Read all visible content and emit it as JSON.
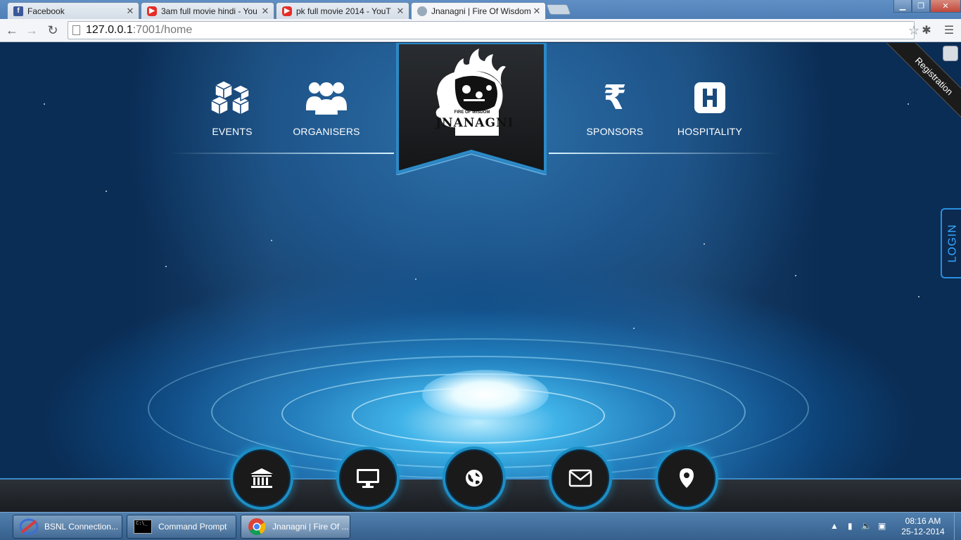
{
  "browser": {
    "tabs": [
      {
        "title": "Facebook",
        "favicon": "facebook-icon",
        "active": false
      },
      {
        "title": "3am full movie hindi - You",
        "favicon": "youtube-icon",
        "active": false
      },
      {
        "title": "pk full movie 2014 - YouT",
        "favicon": "youtube-icon",
        "active": false
      },
      {
        "title": "Jnanagni | Fire Of Wisdom",
        "favicon": "globe-icon",
        "active": true
      }
    ],
    "url_host": "127.0.0.1",
    "url_path": ":7001/home"
  },
  "nav": {
    "events": "EVENTS",
    "organisers": "ORGANISERS",
    "sponsors": "SPONSORS",
    "hospitality": "HOSPITALITY"
  },
  "logo": {
    "brand": "JNANAGNI",
    "tagline": "FIRE OF WISDOM"
  },
  "ribbon": {
    "label": "Registration"
  },
  "login": {
    "label": "LOGIN"
  },
  "footer_icons": [
    "bank-icon",
    "monitor-icon",
    "globe-icon",
    "envelope-icon",
    "map-pin-icon"
  ],
  "taskbar": {
    "items": [
      {
        "label": "BSNL Connection...",
        "icon": "bsnl-icon",
        "active": false
      },
      {
        "label": "Command Prompt",
        "icon": "cmd-icon",
        "active": false
      },
      {
        "label": "Jnanagni | Fire Of ...",
        "icon": "chrome-icon",
        "active": true
      }
    ],
    "time": "08:16 AM",
    "date": "25-12-2014"
  },
  "colors": {
    "accent": "#1c8ec4",
    "login": "#37a8ff",
    "page_bg": "#0a2d55"
  }
}
